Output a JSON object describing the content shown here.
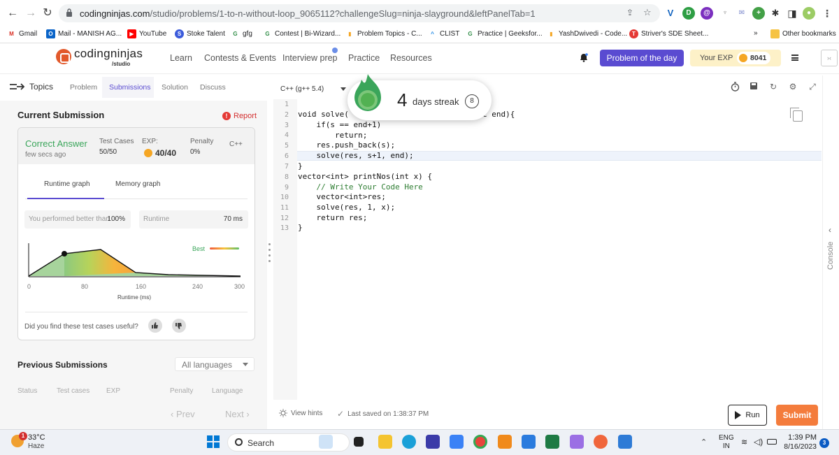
{
  "browser": {
    "url_host": "codingninjas.com",
    "url_path": "/studio/problems/1-to-n-without-loop_9065112?challengeSlug=ninja-slayground&leftPanelTab=1",
    "other_bookmarks": "Other bookmarks",
    "overflow": "»"
  },
  "bookmarks": [
    {
      "label": "Gmail",
      "icon": "gmail-icon",
      "color": "#d93025",
      "glyph": "M"
    },
    {
      "label": "Mail - MANISH AG...",
      "icon": "outlook-icon",
      "color": "#0a64c8",
      "glyph": "O"
    },
    {
      "label": "YouTube",
      "icon": "youtube-icon",
      "color": "#ff0000",
      "glyph": "▶"
    },
    {
      "label": "Stoke Talent",
      "icon": "stoke-icon",
      "color": "#3b5bdb",
      "glyph": "S"
    },
    {
      "label": "gfg",
      "icon": "gfg-icon",
      "color": "#2f8d46",
      "glyph": "G"
    },
    {
      "label": "Contest | Bi-Wizard...",
      "icon": "gfg-icon",
      "color": "#2f8d46",
      "glyph": "G"
    },
    {
      "label": "Problem Topics - C...",
      "icon": "bars-icon",
      "color": "#f5a623",
      "glyph": "▮"
    },
    {
      "label": "CLIST",
      "icon": "clist-icon",
      "color": "#1e88e5",
      "glyph": "^"
    },
    {
      "label": "Practice | Geeksfor...",
      "icon": "gfg-icon",
      "color": "#2f8d46",
      "glyph": "G"
    },
    {
      "label": "YashDwivedi - Code...",
      "icon": "bars-icon",
      "color": "#f5a623",
      "glyph": "▮"
    },
    {
      "label": "Striver's SDE Sheet...",
      "icon": "tuf-icon",
      "color": "#e53935",
      "glyph": "T"
    }
  ],
  "header": {
    "logo_text": "codingninjas",
    "logo_sub": "/studio",
    "nav": [
      "Learn",
      "Contests & Events",
      "Interview prep",
      "Practice",
      "Resources"
    ],
    "potd": "Problem of the day",
    "exp_label": "Your EXP",
    "exp_value": "8041"
  },
  "left_tabs": {
    "topics": "Topics",
    "problem": "Problem",
    "submissions": "Submissions",
    "solution": "Solution",
    "discuss": "Discuss"
  },
  "current_submission": {
    "title": "Current Submission",
    "report": "Report",
    "status": "Correct Answer",
    "when": "few secs ago",
    "test_cases_label": "Test Cases",
    "test_cases_value": "50/50",
    "exp_label": "EXP:",
    "exp_value": "40/40",
    "penalty_label": "Penalty",
    "penalty_value": "0%",
    "language": "C++",
    "graph_tabs": [
      "Runtime graph",
      "Memory graph"
    ],
    "better_than_label": "You performed better than",
    "better_than_value": "100%",
    "runtime_label": "Runtime",
    "runtime_value": "70 ms",
    "best_label": "Best",
    "x_ticks": [
      "0",
      "80",
      "160",
      "240",
      "300"
    ],
    "x_label": "Runtime (ms)",
    "feedback": "Did you find these test cases useful?"
  },
  "previous_submissions": {
    "title": "Previous Submissions",
    "filter": "All languages",
    "columns": [
      "Status",
      "Test cases",
      "EXP",
      "Penalty",
      "Language"
    ],
    "prev": "‹ Prev",
    "next": "Next ›"
  },
  "editor": {
    "language": "C++ (g++ 5.4)",
    "lines": [
      "",
      "void solve(",
      "    if(s == end+1)",
      "        return;",
      "    res.push_back(s);",
      "    solve(res, s+1, end);",
      "}",
      "vector<int> printNos(int x) {",
      "    // Write Your Code Here",
      "    vector<int>res;",
      "    solve(res, 1, x);",
      "    return res;",
      "}"
    ],
    "line2_tail": "c end){",
    "line_numbers": [
      "1",
      "2",
      "3",
      "4",
      "5",
      "6",
      "7",
      "8",
      "9",
      "10",
      "11",
      "12",
      "13"
    ],
    "view_hints": "View hints",
    "saved": "Last saved on 1:38:37 PM",
    "run": "Run",
    "submit": "Submit",
    "console": "Console"
  },
  "streak": {
    "number": "4",
    "label": "days streak",
    "count": "8"
  },
  "taskbar": {
    "temp": "33°C",
    "weather": "Haze",
    "weather_badge": "1",
    "search": "Search",
    "lang_top": "ENG",
    "lang_bottom": "IN",
    "time": "1:39 PM",
    "date": "8/16/2023",
    "notifications": "3"
  },
  "colors": {
    "accent": "#5a4bd1",
    "success": "#3aa55a",
    "submit": "#f47c3c",
    "danger": "#e53935"
  }
}
